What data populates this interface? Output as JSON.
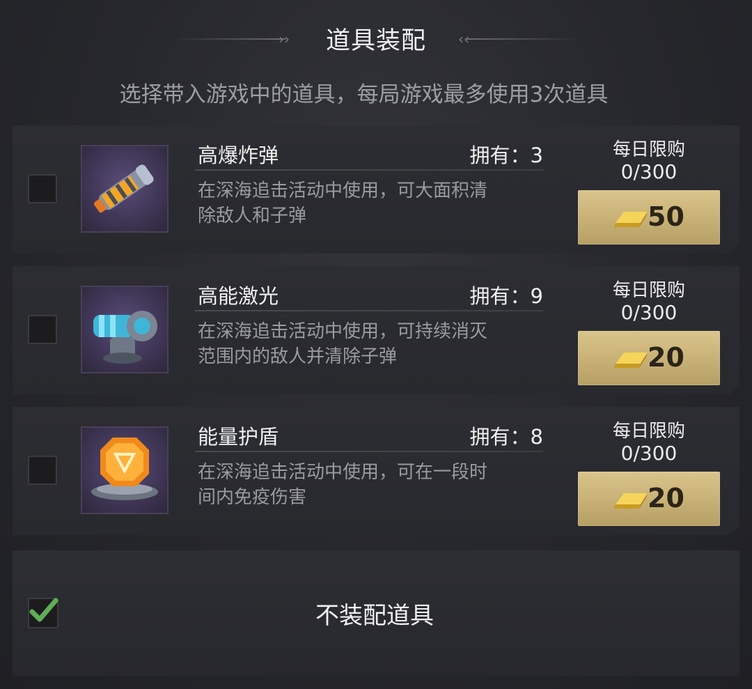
{
  "header": {
    "title": "道具装配",
    "subtitle": "选择带入游戏中的道具，每局游戏最多使用3次道具"
  },
  "items": [
    {
      "name": "高爆炸弹",
      "owned": "拥有：3",
      "desc_line1": "在深海追击活动中使用，可大面积清",
      "desc_line2": "除敌人和子弹",
      "limit_label": "每日限购",
      "limit_count": "0/300",
      "price": "50",
      "icon": "bomb-icon",
      "checked": false
    },
    {
      "name": "高能激光",
      "owned": "拥有：9",
      "desc_line1": "在深海追击活动中使用，可持续消灭",
      "desc_line2": "范围内的敌人并清除子弹",
      "limit_label": "每日限购",
      "limit_count": "0/300",
      "price": "20",
      "icon": "laser-icon",
      "checked": false
    },
    {
      "name": "能量护盾",
      "owned": "拥有：8",
      "desc_line1": "在深海追击活动中使用，可在一段时",
      "desc_line2": "间内免疫伤害",
      "limit_label": "每日限购",
      "limit_count": "0/300",
      "price": "20",
      "icon": "shield-icon",
      "checked": false
    }
  ],
  "no_item": {
    "label": "不装配道具",
    "checked": true
  },
  "colors": {
    "accent_green": "#5fae55",
    "gold": "#d9c48b"
  }
}
